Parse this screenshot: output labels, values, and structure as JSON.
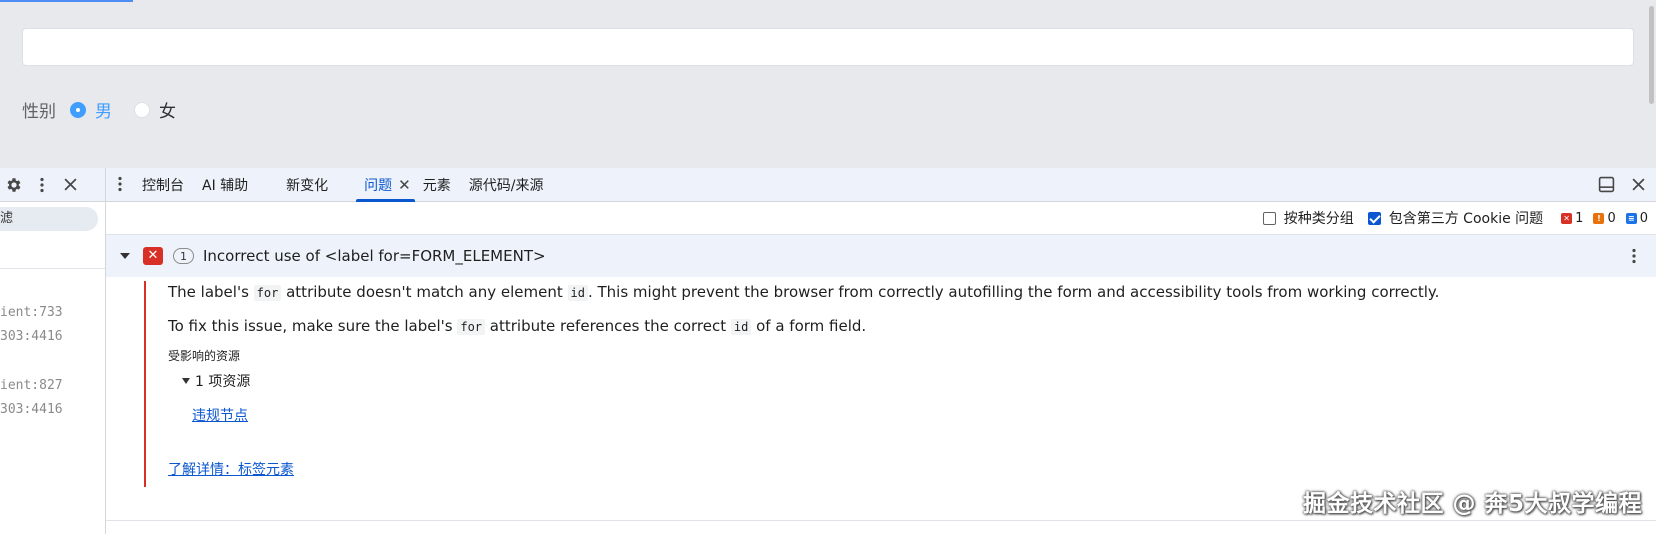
{
  "webpage": {
    "gender_label": "性别",
    "options": [
      {
        "label": "男",
        "checked": true
      },
      {
        "label": "女",
        "checked": false
      }
    ]
  },
  "devtools": {
    "left_panel": {
      "filter_label": "滤",
      "lines": [
        "ient:733",
        "303:4416",
        "ient:827",
        "303:4416"
      ]
    },
    "tabs": [
      {
        "label": "控制台",
        "active": false
      },
      {
        "label": "AI 辅助",
        "active": false
      },
      {
        "label": "新变化",
        "active": false
      },
      {
        "label": "问题",
        "active": true
      },
      {
        "label": "元素",
        "active": false
      },
      {
        "label": "源代码/来源",
        "active": false
      }
    ],
    "toolbar": {
      "group_by_kind": {
        "label": "按种类分组",
        "checked": false
      },
      "third_party_cookie": {
        "label": "包含第三方 Cookie 问题",
        "checked": true
      },
      "counts": {
        "errors": "1",
        "warnings": "0",
        "info": "0"
      },
      "colors": {
        "error": "#d93025",
        "warning": "#e8710a",
        "info": "#1a73e8"
      }
    },
    "issue": {
      "count": "1",
      "title": "Incorrect use of <label for=FORM_ELEMENT>",
      "p1_a": "The label's ",
      "p1_code1": "for",
      "p1_b": " attribute doesn't match any element ",
      "p1_code2": "id",
      "p1_c": ". This might prevent the browser from correctly autofilling the form and accessibility tools from working correctly.",
      "p2_a": "To fix this issue, make sure the label's ",
      "p2_code1": "for",
      "p2_b": " attribute references the correct ",
      "p2_code2": "id",
      "p2_c": " of a form field.",
      "affected_label": "受影响的资源",
      "resources_toggle": "1 项资源",
      "violating_node_link": "违规节点",
      "learn_more_link": "了解详情：标签元素"
    }
  },
  "watermark": "掘金技术社区 @ 奔5大叔学编程"
}
